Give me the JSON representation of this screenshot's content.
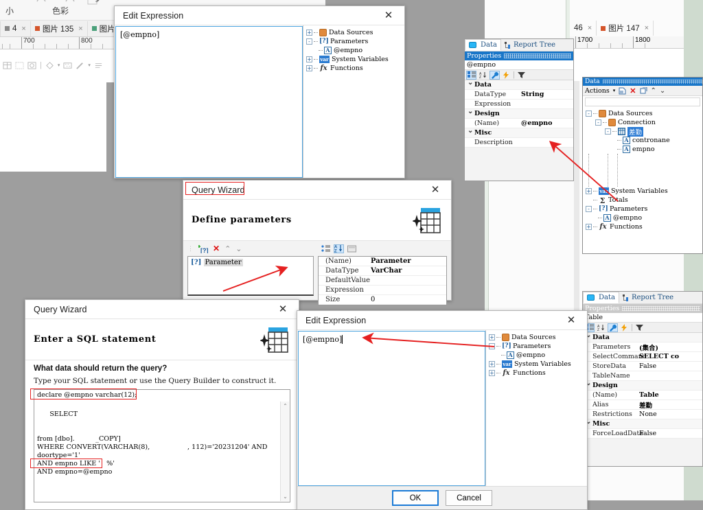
{
  "host_top_left": {
    "ribbon_labels": [
      "小",
      "色彩"
    ],
    "image_tabs": [
      {
        "label": "4",
        "swatch": "#888888",
        "close": "×"
      },
      {
        "label": "图片 135",
        "swatch": "#d4542a",
        "close": "×"
      },
      {
        "label": "图片",
        "swatch": "#4aa07a",
        "close": "×"
      }
    ],
    "ruler_ticks": [
      "700",
      "800"
    ]
  },
  "host_top_right": {
    "image_tabs": [
      {
        "label": "46",
        "swatch": "",
        "close": "×"
      },
      {
        "label": "图片 147",
        "swatch": "#d4542a",
        "close": "×"
      }
    ],
    "ruler_ticks": [
      "1700",
      "1800"
    ]
  },
  "properties_panel": {
    "tabs": [
      {
        "label": "Data",
        "icon": "database-icon",
        "selected": true
      },
      {
        "label": "Report Tree",
        "icon": "tree-icon",
        "selected": false
      }
    ],
    "header": "Properties",
    "object_name": "@empno",
    "toolbar_buttons": [
      "categorized-icon",
      "alphabetical-icon",
      "properties-icon",
      "events-icon",
      "filter-icon"
    ],
    "rows": [
      {
        "category": "Data"
      },
      {
        "name": "DataType",
        "value": "String",
        "bold": true
      },
      {
        "name": "Expression",
        "value": ""
      },
      {
        "category": "Design"
      },
      {
        "name": "(Name)",
        "value": "@empno",
        "bold": true
      },
      {
        "category": "Misc"
      },
      {
        "name": "Description",
        "value": ""
      }
    ]
  },
  "data_panel": {
    "header": "Data",
    "actions_label": "Actions",
    "action_icons": [
      "dropdown-icon",
      "new-item-icon",
      "delete-icon",
      "edit-icon",
      "move-up-icon",
      "move-down-icon"
    ],
    "tree": [
      {
        "depth": 0,
        "label": "Data Sources",
        "icon": "datasource-icon",
        "expander": "-"
      },
      {
        "depth": 1,
        "label": "Connection",
        "icon": "connection-icon",
        "expander": "-"
      },
      {
        "depth": 2,
        "label": "差勤",
        "icon": "table-icon",
        "expander": "-",
        "selected": true
      },
      {
        "depth": 3,
        "label": "contronane",
        "icon": "field-icon"
      },
      {
        "depth": 3,
        "label": "empno",
        "icon": "field-icon"
      },
      {
        "depth": 0,
        "label": "System Variables",
        "icon": "variable-icon",
        "expander": "+"
      },
      {
        "depth": 0,
        "label": "Totals",
        "icon": "totals-icon"
      },
      {
        "depth": 0,
        "label": "Parameters",
        "icon": "parameters-icon",
        "expander": "-"
      },
      {
        "depth": 1,
        "label": "@empno",
        "icon": "field-icon"
      },
      {
        "depth": 0,
        "label": "Functions",
        "icon": "functions-icon",
        "expander": "+"
      }
    ]
  },
  "table_properties_panel": {
    "tabs": [
      {
        "label": "Data",
        "icon": "database-icon",
        "selected": true
      },
      {
        "label": "Report Tree",
        "icon": "tree-icon",
        "selected": false
      }
    ],
    "header": "Properties",
    "object_name": "Table",
    "rows": [
      {
        "category": "Data"
      },
      {
        "name": "Parameters",
        "value": "(集合)",
        "bold": true
      },
      {
        "name": "SelectCommand",
        "value": "SELECT co",
        "bold": true
      },
      {
        "name": "StoreData",
        "value": "False"
      },
      {
        "name": "TableName",
        "value": ""
      },
      {
        "category": "Design"
      },
      {
        "name": "(Name)",
        "value": "Table",
        "bold": true
      },
      {
        "name": "Alias",
        "value": "差勤",
        "bold": true
      },
      {
        "name": "Restrictions",
        "value": "None"
      },
      {
        "category": "Misc"
      },
      {
        "name": "ForceLoadData",
        "value": "False"
      }
    ]
  },
  "edit_expression_top": {
    "title": "Edit Expression",
    "close": "✕",
    "expression": "[@empno]",
    "tree": [
      {
        "depth": 0,
        "label": "Data Sources",
        "icon": "datasource-icon",
        "expander": "+"
      },
      {
        "depth": 0,
        "label": "Parameters",
        "icon": "parameters-icon",
        "expander": "-"
      },
      {
        "depth": 1,
        "label": "@empno",
        "icon": "field-icon"
      },
      {
        "depth": 0,
        "label": "System Variables",
        "icon": "variable-icon",
        "expander": "+"
      },
      {
        "depth": 0,
        "label": "Functions",
        "icon": "functions-icon",
        "expander": "+"
      }
    ]
  },
  "edit_expression_bottom": {
    "title": "Edit Expression",
    "close": "✕",
    "expression": "[@empno]",
    "tree": [
      {
        "depth": 0,
        "label": "Data Sources",
        "icon": "datasource-icon",
        "expander": "+"
      },
      {
        "depth": 0,
        "label": "Parameters",
        "icon": "parameters-icon",
        "expander": "-"
      },
      {
        "depth": 1,
        "label": "@empno",
        "icon": "field-icon"
      },
      {
        "depth": 0,
        "label": "System Variables",
        "icon": "variable-icon",
        "expander": "+"
      },
      {
        "depth": 0,
        "label": "Functions",
        "icon": "functions-icon",
        "expander": "+"
      }
    ],
    "ok_label": "OK",
    "cancel_label": "Cancel"
  },
  "query_wizard_params": {
    "title": "Query Wizard",
    "close": "✕",
    "heading": "Define parameters",
    "toolbar_icons": [
      "add-parameter-icon",
      "delete-parameter-icon",
      "move-up-icon",
      "move-down-icon"
    ],
    "param_list": [
      {
        "label": "Parameter",
        "icon": "parameter-icon",
        "selected": true
      }
    ],
    "grid_toolbar_icons": [
      "categorized-icon",
      "alphabetical-icon",
      "page-icon"
    ],
    "grid_rows": [
      {
        "name": "(Name)",
        "value": "Parameter",
        "bold": true
      },
      {
        "name": "DataType",
        "value": "VarChar",
        "bold": true
      },
      {
        "name": "DefaultValue",
        "value": ""
      },
      {
        "name": "Expression",
        "value": ""
      },
      {
        "name": "Size",
        "value": "0"
      }
    ]
  },
  "query_wizard_sql": {
    "title": "Query Wizard",
    "close": "✕",
    "heading": "Enter a SQL statement",
    "question": "What data should return the query?",
    "hint": "Type your SQL statement or use the Query Builder to construct it.",
    "sql_line_highlighted_1": "declare @empno varchar(12);",
    "sql_text": "SELECT\n\n\nfrom [dbo].          _COPY]\nWHERE CONVERT(VARCHAR(8),                  , 112)='20231204' AND\ndoortype='1'\nAND empno LIKE '   %'\nAND empno=@empno",
    "sql_highlight_line": "AND empno=@empno",
    "scroll_up": "⌃",
    "scroll_down": "⌄"
  },
  "annotations": {
    "red_boxes": [
      "query-wizard-title",
      "declare-statement-line",
      "and-empno-line"
    ],
    "arrows": [
      {
        "from": "table-properties",
        "to": "name-property-value"
      },
      {
        "from": "sql-wizard",
        "to": "parameter-list"
      },
      {
        "from": "parameters-tree-node",
        "to": "expression-editor"
      }
    ],
    "arrow_color": "#e52020"
  }
}
